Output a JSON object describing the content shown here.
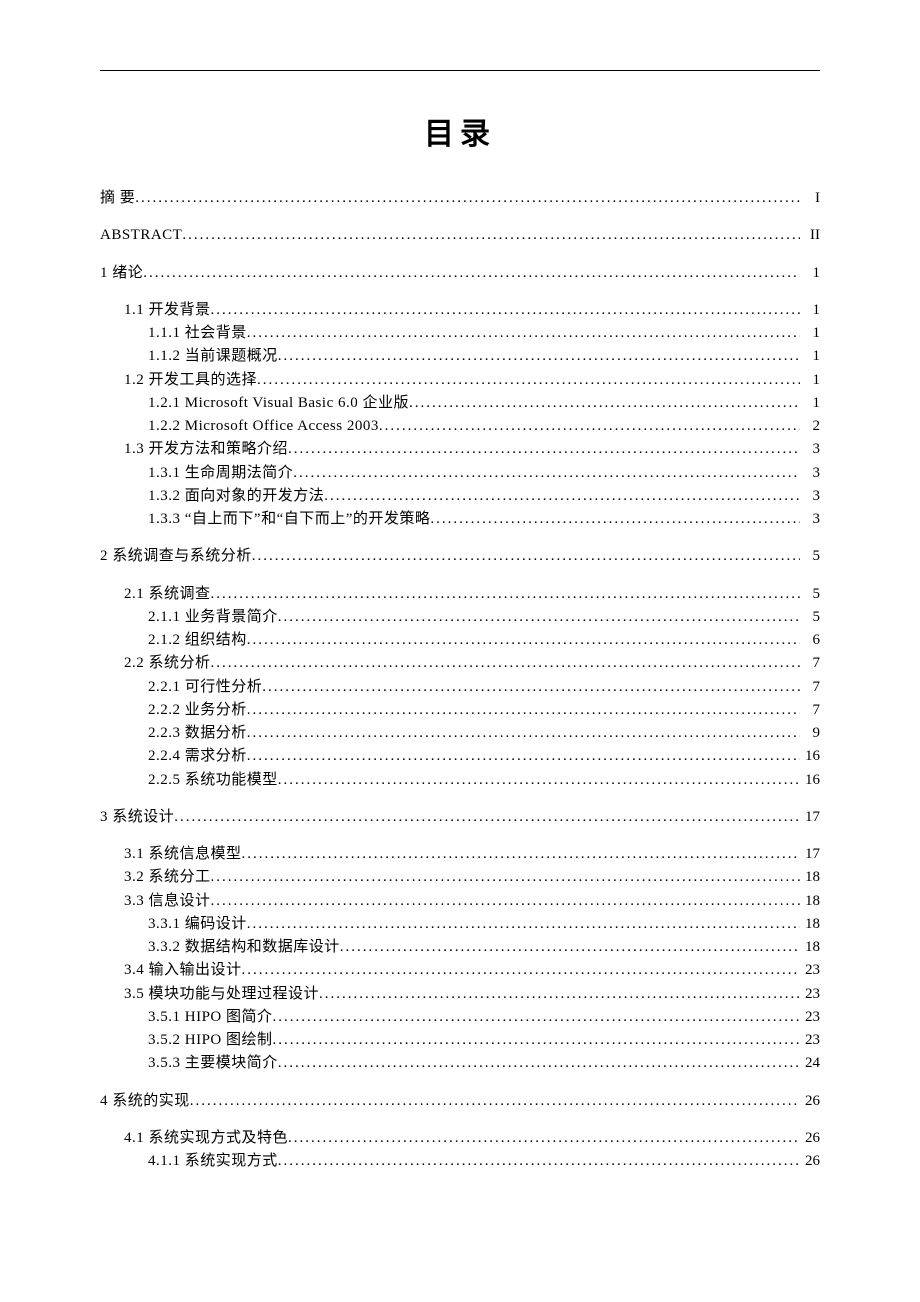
{
  "title": "目录",
  "toc": [
    {
      "level": 0,
      "label": "摘 要",
      "page": "I",
      "block_start": true
    },
    {
      "level": 0,
      "label": "ABSTRACT",
      "page": "II",
      "block_start": true
    },
    {
      "level": 0,
      "label": "1 绪论",
      "page": "1",
      "block_start": true
    },
    {
      "level": 1,
      "label": "1.1 开发背景",
      "page": "1",
      "block_start": true
    },
    {
      "level": 2,
      "label": "1.1.1 社会背景 ",
      "page": "1"
    },
    {
      "level": 2,
      "label": "1.1.2 当前课题概况 ",
      "page": "1"
    },
    {
      "level": 1,
      "label": "1.2 开发工具的选择",
      "page": "1"
    },
    {
      "level": 2,
      "label": "1.2.1 Microsoft Visual Basic 6.0 企业版 ",
      "page": "1"
    },
    {
      "level": 2,
      "label": "1.2.2 Microsoft Office Access 2003 ",
      "page": "2"
    },
    {
      "level": 1,
      "label": "1.3 开发方法和策略介绍",
      "page": "3"
    },
    {
      "level": 2,
      "label": "1.3.1 生命周期法简介 ",
      "page": "3"
    },
    {
      "level": 2,
      "label": "1.3.2 面向对象的开发方法 ",
      "page": "3"
    },
    {
      "level": 2,
      "label": "1.3.3 “自上而下”和“自下而上”的开发策略 ",
      "page": "3"
    },
    {
      "level": 0,
      "label": "2 系统调查与系统分析",
      "page": "5",
      "block_start": true
    },
    {
      "level": 1,
      "label": "2.1 系统调查",
      "page": "5",
      "block_start": true
    },
    {
      "level": 2,
      "label": "2.1.1 业务背景简介 ",
      "page": "5"
    },
    {
      "level": 2,
      "label": "2.1.2 组织结构 ",
      "page": "6"
    },
    {
      "level": 1,
      "label": "2.2 系统分析",
      "page": "7"
    },
    {
      "level": 2,
      "label": "2.2.1 可行性分析 ",
      "page": "7"
    },
    {
      "level": 2,
      "label": "2.2.2 业务分析 ",
      "page": "7"
    },
    {
      "level": 2,
      "label": "2.2.3 数据分析 ",
      "page": "9"
    },
    {
      "level": 2,
      "label": "2.2.4 需求分析 ",
      "page": "16"
    },
    {
      "level": 2,
      "label": "2.2.5 系统功能模型 ",
      "page": "16"
    },
    {
      "level": 0,
      "label": "3 系统设计",
      "page": "17",
      "block_start": true
    },
    {
      "level": 1,
      "label": "3.1 系统信息模型",
      "page": "17",
      "block_start": true
    },
    {
      "level": 1,
      "label": "3.2 系统分工",
      "page": "18"
    },
    {
      "level": 1,
      "label": "3.3 信息设计",
      "page": "18"
    },
    {
      "level": 2,
      "label": "3.3.1 编码设计 ",
      "page": "18"
    },
    {
      "level": 2,
      "label": "3.3.2 数据结构和数据库设计 ",
      "page": "18"
    },
    {
      "level": 1,
      "label": "3.4 输入输出设计",
      "page": "23"
    },
    {
      "level": 1,
      "label": "3.5 模块功能与处理过程设计",
      "page": "23"
    },
    {
      "level": 2,
      "label": "3.5.1 HIPO 图简介",
      "page": "23"
    },
    {
      "level": 2,
      "label": "3.5.2 HIPO 图绘制",
      "page": "23"
    },
    {
      "level": 2,
      "label": "3.5.3 主要模块简介 ",
      "page": "24"
    },
    {
      "level": 0,
      "label": "4 系统的实现",
      "page": "26",
      "block_start": true
    },
    {
      "level": 1,
      "label": "4.1 系统实现方式及特色",
      "page": "26",
      "block_start": true
    },
    {
      "level": 2,
      "label": "4.1.1 系统实现方式 ",
      "page": "26"
    }
  ]
}
